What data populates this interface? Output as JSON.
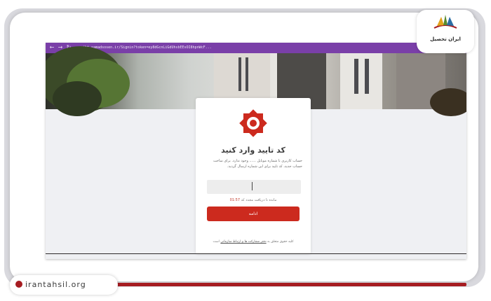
{
  "browser": {
    "url": "sibt.samadsosen.ir/Signin?token=ey8dGcnLiGdUhsbEEsOI8hpnWcF...",
    "nav_back": "←",
    "nav_forward": "→",
    "nav_reload": "↻"
  },
  "card": {
    "title": "کد تایید وارد کنید",
    "description": "حساب کاربری با شماره موبایل ...... وجود ندارد. برای ساخت حساب جدید، کد تایید برای این شماره ارسال گردید.",
    "input_value": "",
    "timer_value": "01:57",
    "timer_text": "مانده تا دریافت مجدد کد",
    "continue_label": "ادامه",
    "footer_text": "کلیه حقوق متعلق به",
    "footer_link": "دفتر مشارکت ها و ارتباط سازمانی",
    "footer_suffix": "است"
  },
  "branding": {
    "site_name": "ایران تحصیل",
    "site_url": "irantahsil.org",
    "accent_color": "#a61c21",
    "button_color": "#cc2a1e",
    "browser_bar_color": "#7a3fa8"
  }
}
